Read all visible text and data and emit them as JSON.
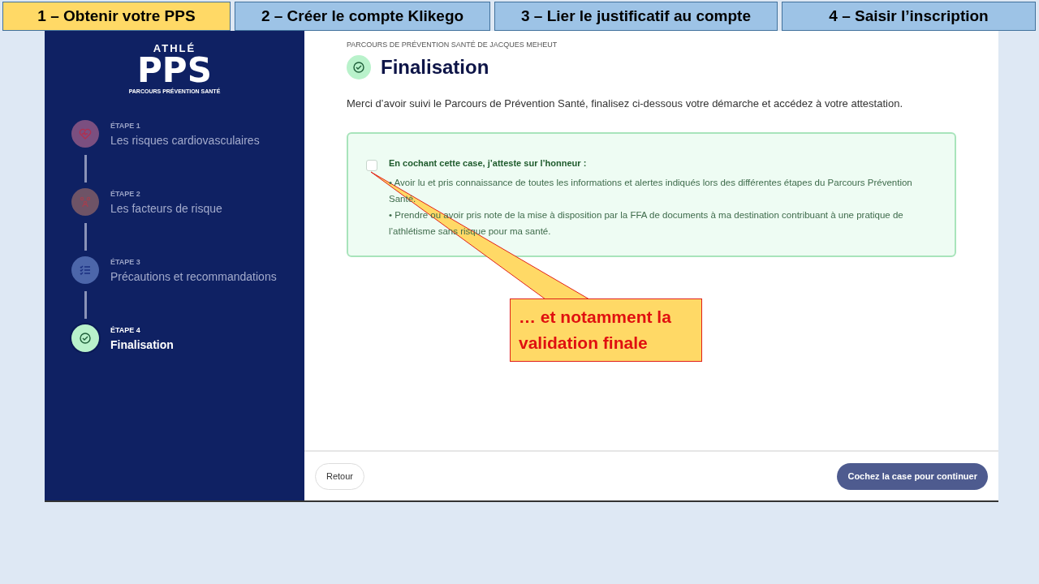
{
  "tabs": [
    {
      "label": "1 – Obtenir votre PPS",
      "selected": true
    },
    {
      "label": "2 – Créer le compte Klikego",
      "selected": false
    },
    {
      "label": "3 – Lier le justificatif au compte",
      "selected": false
    },
    {
      "label": "4 – Saisir l’inscription",
      "selected": false
    }
  ],
  "sidebar": {
    "logo": {
      "top": "ATHLÉ",
      "main": "PPS",
      "tagline": "PARCOURS PRÉVENTION SANTÉ"
    },
    "steps": [
      {
        "label": "ÉTAPE 1",
        "title": "Les risques cardiovasculaires",
        "color": "#7b4f80",
        "selected": false
      },
      {
        "label": "ÉTAPE 2",
        "title": "Les facteurs de risque",
        "color": "#6e5366",
        "selected": false
      },
      {
        "label": "ÉTAPE 3",
        "title": "Précautions et recommandations",
        "color": "#4c66aa",
        "selected": false
      },
      {
        "label": "ÉTAPE 4",
        "title": "Finalisation",
        "color": "#b9f2cb",
        "selected": true
      }
    ]
  },
  "main": {
    "breadcrumb": "PARCOURS DE PRÉVENTION SANTÉ DE JACQUES MEHEUT",
    "title": "Finalisation",
    "intro": "Merci d’avoir suivi le Parcours de Prévention Santé, finalisez ci-dessous votre démarche et accédez à votre attestation.",
    "attestation": {
      "checked": false,
      "heading": "En cochant cette case, j’atteste sur l’honneur :",
      "items": [
        "• Avoir lu et pris connaissance de toutes les informations et alertes indiqués lors des différentes étapes du Parcours Prévention Santé.",
        "• Prendre ou avoir pris note de la mise à disposition par la FFA de documents à ma destination contribuant à une pratique de l’athlétisme sans risque pour ma santé."
      ]
    }
  },
  "footer": {
    "back": "Retour",
    "continue": {
      "label": "Cochez la case pour continuer",
      "disabled": true
    }
  },
  "callout": {
    "text": "… et notamment la validation finale"
  }
}
